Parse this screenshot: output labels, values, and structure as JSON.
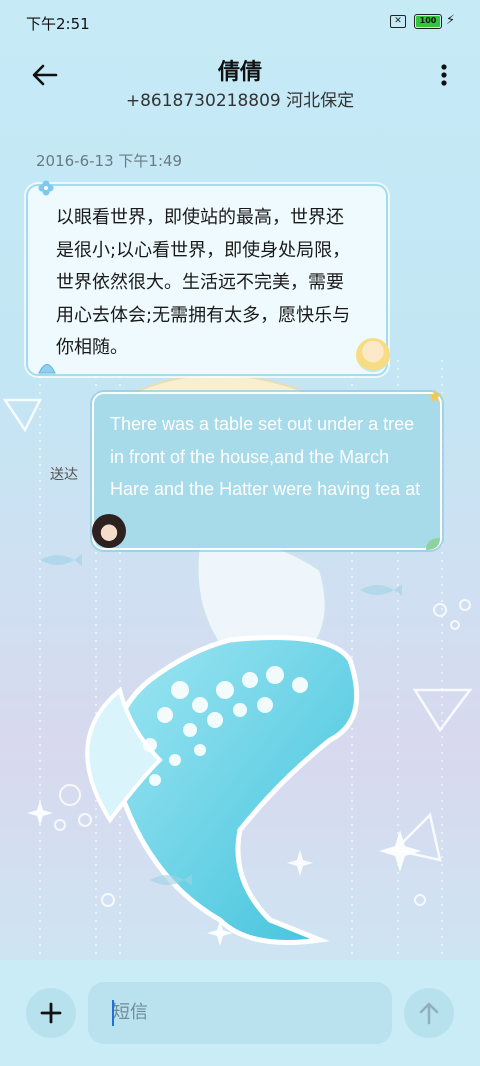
{
  "status_bar": {
    "time": "下午2:51",
    "battery": "100"
  },
  "header": {
    "contact_name": "倩倩",
    "contact_detail": "+8618730218809 河北保定"
  },
  "conversation": {
    "timestamp": "2016-6-13 下午1:49",
    "incoming_message": "以眼看世界，即使站的最高，世界还是很小;以心看世界，即使身处局限，世界依然很大。生活远不完美，需要用心去体会;无需拥有太多，愿快乐与你相随。",
    "outgoing_message": "There was a table set out under a tree in front of the house,and the March Hare and the Hatter were having tea at it.",
    "outgoing_status": "送达"
  },
  "composer": {
    "placeholder": "短信"
  },
  "colors": {
    "incoming_bubble": "#eefafd",
    "outgoing_bubble": "#a7dbea",
    "battery_fill": "#33c63a",
    "caret": "#1e6fe0"
  },
  "icons": [
    "back-arrow-icon",
    "more-vertical-icon",
    "plus-icon",
    "send-arrow-icon",
    "sim-card-icon",
    "battery-icon",
    "charging-bolt-icon"
  ]
}
